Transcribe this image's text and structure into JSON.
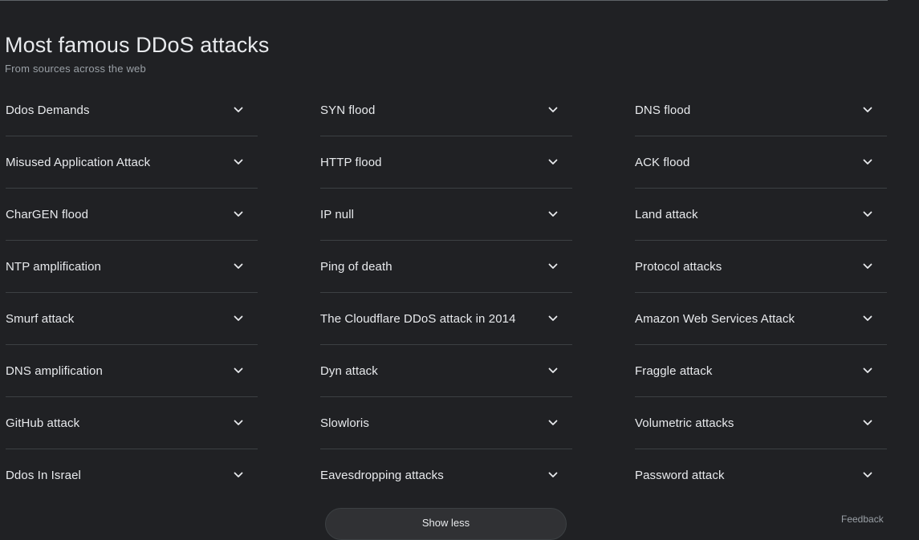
{
  "section": {
    "title": "Most famous DDoS attacks",
    "subtitle": "From sources across the web"
  },
  "columns": [
    {
      "items": [
        {
          "label": "Ddos Demands"
        },
        {
          "label": "Misused Application Attack"
        },
        {
          "label": "CharGEN flood"
        },
        {
          "label": "NTP amplification"
        },
        {
          "label": "Smurf attack"
        },
        {
          "label": "DNS amplification"
        },
        {
          "label": "GitHub attack"
        },
        {
          "label": "Ddos In Israel"
        }
      ]
    },
    {
      "items": [
        {
          "label": "SYN flood"
        },
        {
          "label": "HTTP flood"
        },
        {
          "label": "IP null"
        },
        {
          "label": "Ping of death"
        },
        {
          "label": "The Cloudflare DDoS attack in 2014"
        },
        {
          "label": "Dyn attack"
        },
        {
          "label": "Slowloris"
        },
        {
          "label": "Eavesdropping attacks"
        }
      ]
    },
    {
      "items": [
        {
          "label": "DNS flood"
        },
        {
          "label": "ACK flood"
        },
        {
          "label": "Land attack"
        },
        {
          "label": "Protocol attacks"
        },
        {
          "label": "Amazon Web Services Attack"
        },
        {
          "label": "Fraggle attack"
        },
        {
          "label": "Volumetric attacks"
        },
        {
          "label": "Password attack"
        }
      ]
    }
  ],
  "footer": {
    "show_less_label": "Show less",
    "feedback_label": "Feedback"
  },
  "icons": {
    "expand": "chevron-down-icon"
  },
  "colors": {
    "background": "#202124",
    "text": "#e8eaed",
    "muted": "#9aa0a6",
    "divider": "#3c4043"
  }
}
